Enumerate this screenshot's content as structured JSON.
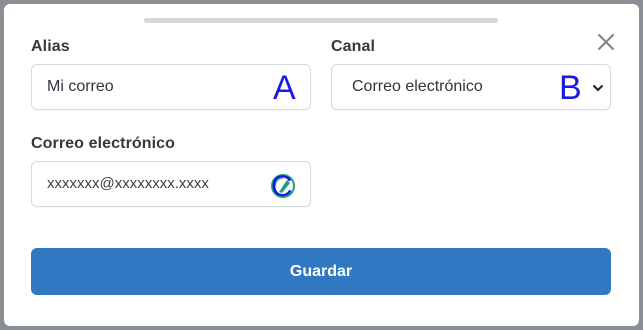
{
  "form": {
    "alias_label": "Alias",
    "alias_value": "Mi correo",
    "channel_label": "Canal",
    "channel_selected": "Correo electrónico",
    "email_label": "Correo electrónico",
    "email_value": "xxxxxxx@xxxxxxxx.xxxx",
    "save_label": "Guardar"
  },
  "annotations": {
    "a": "A",
    "b": "B",
    "c": "C"
  },
  "icons": {
    "close": "close-icon",
    "chevron": "chevron-down-icon",
    "email_autofill": "autofill-icon"
  },
  "colors": {
    "primary_button": "#3079c2",
    "annotation": "#1919e6",
    "autofill_icon": "#1f9e7c"
  }
}
